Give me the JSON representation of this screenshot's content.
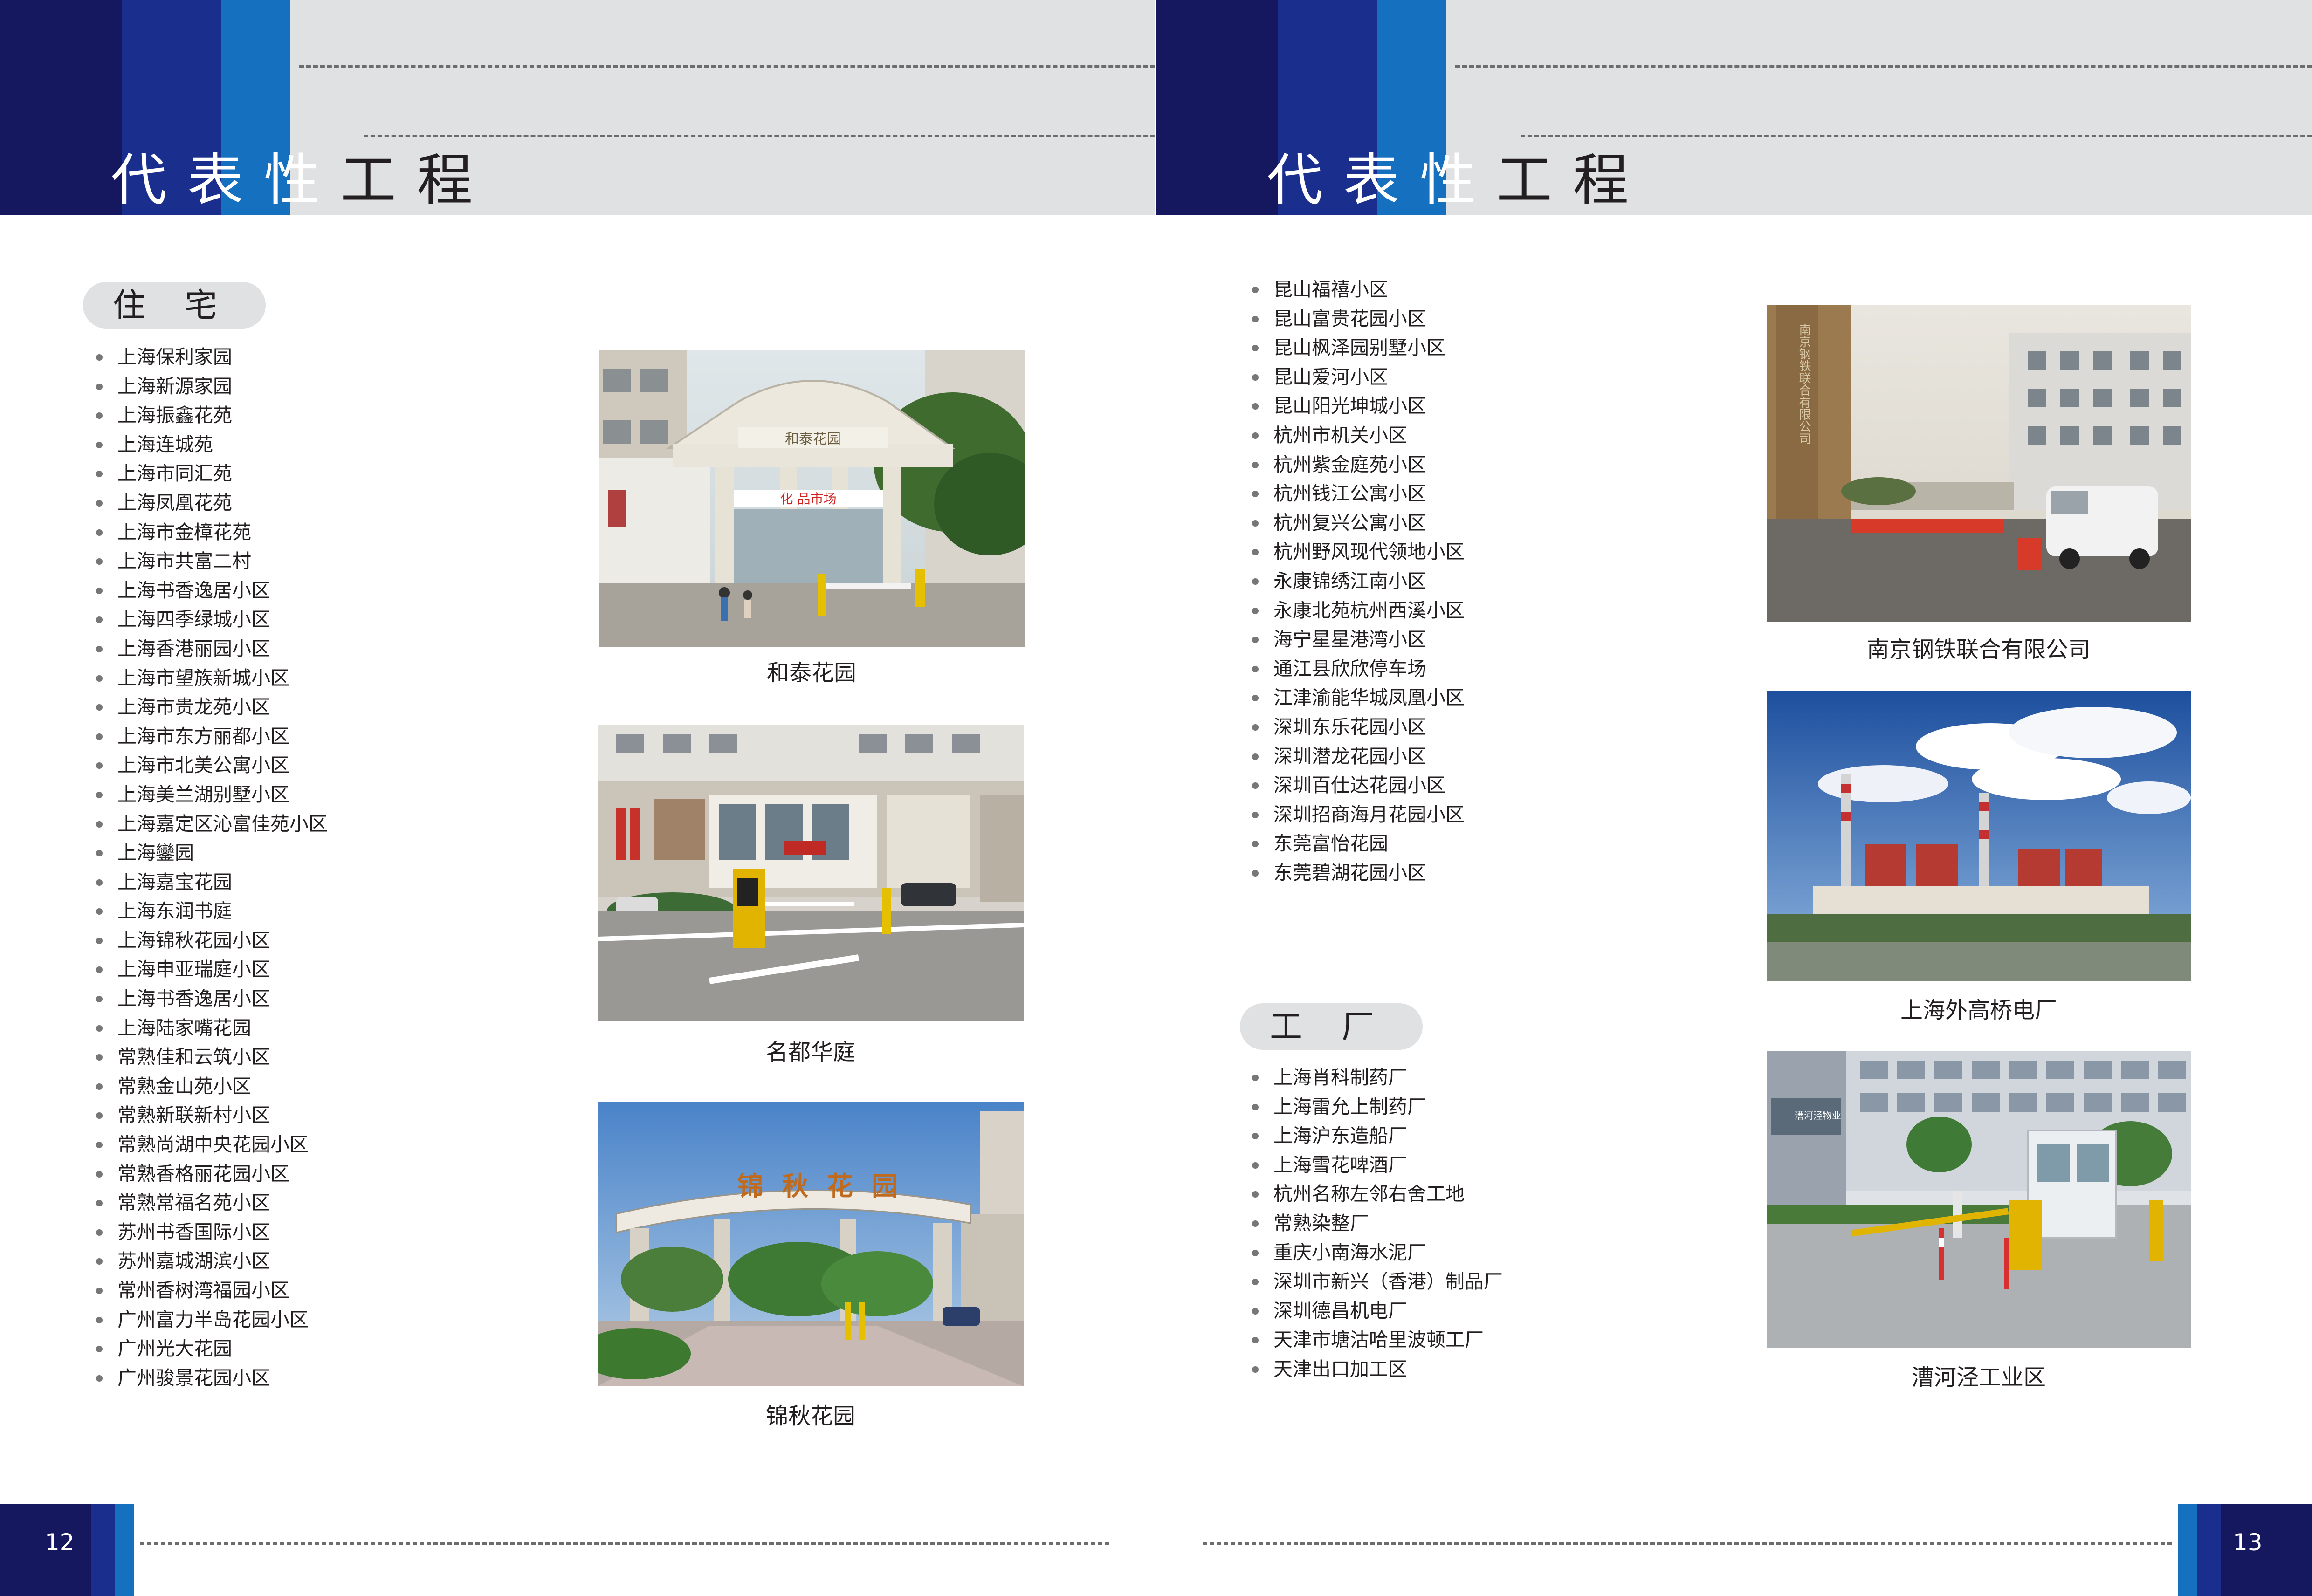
{
  "left_page": {
    "header_title": "代表性工程",
    "section_label": "住宅",
    "residential_items": [
      "上海保利家园",
      "上海新源家园",
      "上海振鑫花苑",
      "上海连城苑",
      "上海市同汇苑",
      "上海凤凰花苑",
      "上海市金樟花苑",
      "上海市共富二村",
      "上海书香逸居小区",
      "上海四季绿城小区",
      "上海香港丽园小区",
      "上海市望族新城小区",
      "上海市贵龙苑小区",
      "上海市东方丽都小区",
      "上海市北美公寓小区",
      "上海美兰湖别墅小区",
      "上海嘉定区沁富佳苑小区",
      "上海鑾园",
      "上海嘉宝花园",
      "上海东润书庭",
      "上海锦秋花园小区",
      "上海申亚瑞庭小区",
      "上海书香逸居小区",
      "上海陆家嘴花园",
      "常熟佳和云筑小区",
      "常熟金山苑小区",
      "常熟新联新村小区",
      "常熟尚湖中央花园小区",
      "常熟香格丽花园小区",
      "常熟常福名苑小区",
      "苏州书香国际小区",
      "苏州嘉城湖滨小区",
      "常州香树湾福园小区",
      "广州富力半岛花园小区",
      "广州光大花园",
      "广州骏景花园小区"
    ],
    "photos": [
      {
        "caption": "和泰花园",
        "sign_text": "和泰花园",
        "banner_text": "化 品市场"
      },
      {
        "caption": "名都华庭"
      },
      {
        "caption": "锦秋花园",
        "sign_text": "锦秋花园"
      }
    ],
    "page_number": "12"
  },
  "right_page": {
    "header_title": "代表性工程",
    "residential_items_cont": [
      "昆山福禧小区",
      "昆山富贵花园小区",
      "昆山枫泽园别墅小区",
      "昆山爱河小区",
      "昆山阳光坤城小区",
      "杭州市机关小区",
      "杭州紫金庭苑小区",
      "杭州钱江公寓小区",
      "杭州复兴公寓小区",
      "杭州野风现代领地小区",
      "永康锦绣江南小区",
      "永康北苑杭州西溪小区",
      "海宁星星港湾小区",
      "通江县欣欣停车场",
      "江津渝能华城凤凰小区",
      "深圳东乐花园小区",
      "深圳潜龙花园小区",
      "深圳百仕达花园小区",
      "深圳招商海月花园小区",
      "东莞富怡花园",
      "东莞碧湖花园小区"
    ],
    "section_label": "工厂",
    "factory_items": [
      "上海肖科制药厂",
      "上海雷允上制药厂",
      "上海沪东造船厂",
      "上海雪花啤酒厂",
      "杭州名称左邻右舍工地",
      "常熟染整厂",
      "重庆小南海水泥厂",
      "深圳市新兴（香港）制品厂",
      "深圳德昌机电厂",
      "天津市塘沽哈里波顿工厂",
      "天津出口加工区"
    ],
    "photos": [
      {
        "caption": "南京钢铁联合有限公司",
        "sign_text": "南京钢铁联合有限公司"
      },
      {
        "caption": "上海外高桥电厂"
      },
      {
        "caption": "漕河泾工业区",
        "sign_text": "漕河泾物业"
      }
    ],
    "page_number": "13"
  },
  "colors": {
    "dark_navy": "#16185f",
    "royal_blue": "#1a2e8e",
    "bright_blue": "#1570c0",
    "header_gray": "#e0e1e2"
  }
}
